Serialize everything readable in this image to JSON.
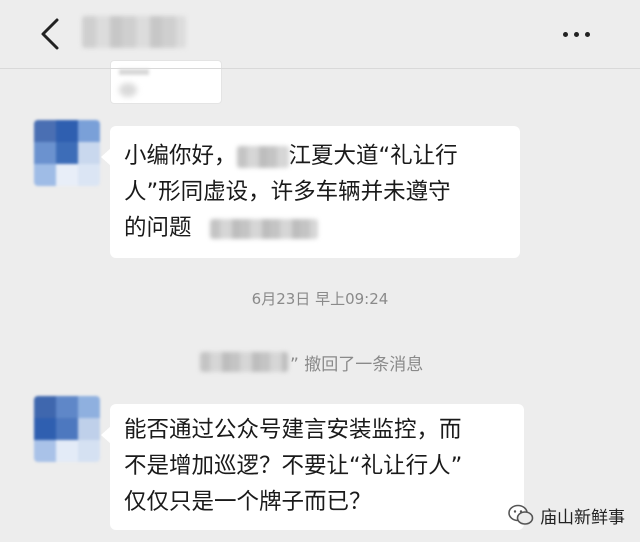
{
  "header": {
    "contact_name": "",
    "back_icon": "chevron-left-icon",
    "more_icon": "more-dots-icon"
  },
  "messages": [
    {
      "line1_pre": "小编你好，",
      "line1_post": "江夏大道“礼让行",
      "line2": "人”形同虚设，许多车辆并未遵守",
      "line3": "的问题"
    },
    {
      "line1": "能否通过公众号建言安装监控，而",
      "line2": "不是增加巡逻？不要让“礼让行人”",
      "line3": "仅仅只是一个牌子而已？"
    }
  ],
  "timestamp": "6月23日 早上09:24",
  "recall_text": "” 撤回了一条消息",
  "watermark": {
    "icon": "wechat-icon",
    "text": "庙山新鲜事"
  },
  "colors": {
    "background": "#ededed",
    "bubble": "#ffffff",
    "system_text": "#8a8a8a",
    "avatar_blue": "#3d6db8"
  }
}
